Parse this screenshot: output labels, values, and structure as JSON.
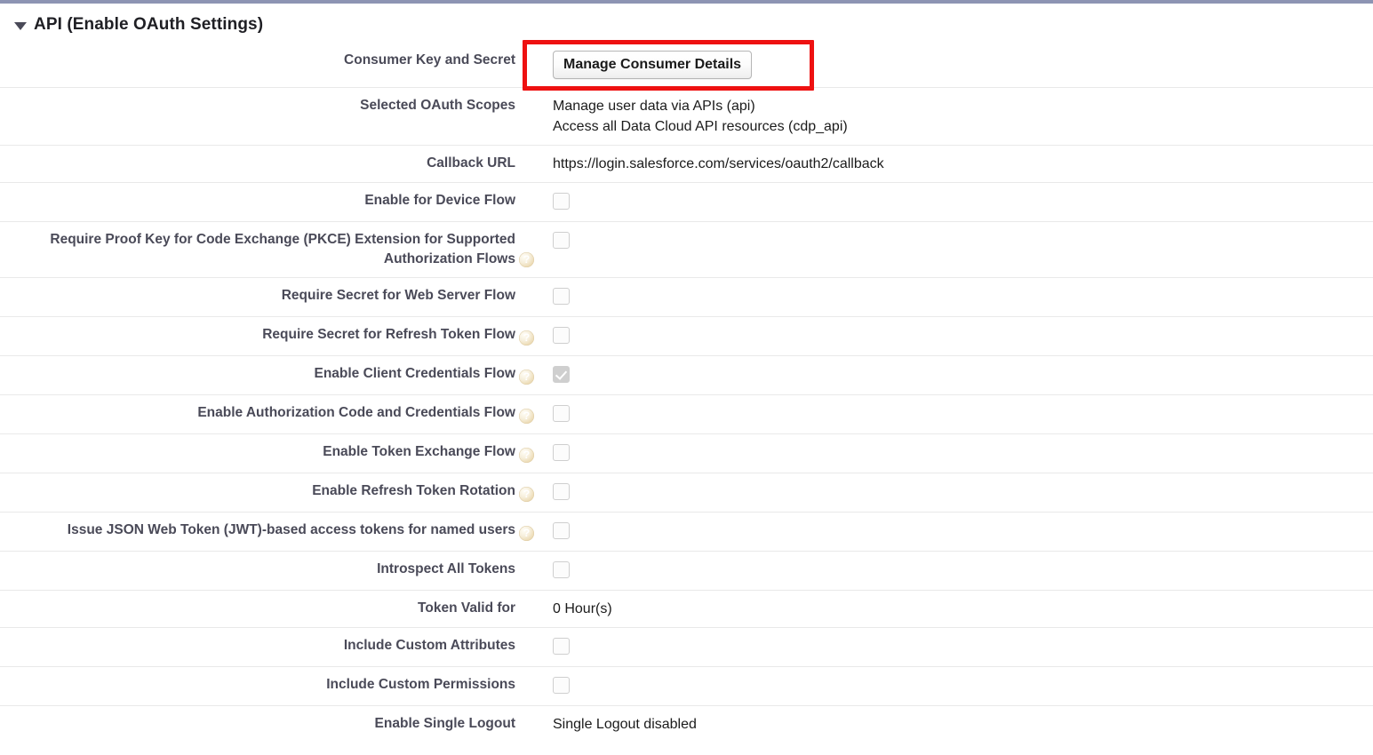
{
  "section": {
    "title": "API (Enable OAuth Settings)",
    "expanded": true,
    "twisty_icon": "caret-down-icon"
  },
  "highlight": {
    "color": "#ee1111",
    "target": "manage-consumer-details-button"
  },
  "rows": [
    {
      "label": "Consumer Key and Secret",
      "type": "button",
      "button_label": "Manage Consumer Details",
      "has_help": false
    },
    {
      "label": "Selected OAuth Scopes",
      "type": "multiline",
      "values": [
        "Manage user data via APIs (api)",
        "Access all Data Cloud API resources (cdp_api)"
      ],
      "has_help": false
    },
    {
      "label": "Callback URL",
      "type": "text",
      "value": "https://login.salesforce.com/services/oauth2/callback",
      "has_help": false
    },
    {
      "label": "Enable for Device Flow",
      "type": "checkbox",
      "checked": false,
      "has_help": false
    },
    {
      "label": "Require Proof Key for Code Exchange (PKCE) Extension for Supported Authorization Flows",
      "type": "checkbox",
      "checked": false,
      "has_help": true
    },
    {
      "label": "Require Secret for Web Server Flow",
      "type": "checkbox",
      "checked": false,
      "has_help": false
    },
    {
      "label": "Require Secret for Refresh Token Flow",
      "type": "checkbox",
      "checked": false,
      "has_help": true
    },
    {
      "label": "Enable Client Credentials Flow",
      "type": "checkbox",
      "checked": true,
      "has_help": true
    },
    {
      "label": "Enable Authorization Code and Credentials Flow",
      "type": "checkbox",
      "checked": false,
      "has_help": true
    },
    {
      "label": "Enable Token Exchange Flow",
      "type": "checkbox",
      "checked": false,
      "has_help": true
    },
    {
      "label": "Enable Refresh Token Rotation",
      "type": "checkbox",
      "checked": false,
      "has_help": true
    },
    {
      "label": "Issue JSON Web Token (JWT)-based access tokens for named users",
      "type": "checkbox",
      "checked": false,
      "has_help": true
    },
    {
      "label": "Introspect All Tokens",
      "type": "checkbox",
      "checked": false,
      "has_help": false
    },
    {
      "label": "Token Valid for",
      "type": "text",
      "value": "0 Hour(s)",
      "has_help": false
    },
    {
      "label": "Include Custom Attributes",
      "type": "checkbox",
      "checked": false,
      "has_help": false
    },
    {
      "label": "Include Custom Permissions",
      "type": "checkbox",
      "checked": false,
      "has_help": false
    },
    {
      "label": "Enable Single Logout",
      "type": "text",
      "value": "Single Logout disabled",
      "has_help": false
    }
  ]
}
